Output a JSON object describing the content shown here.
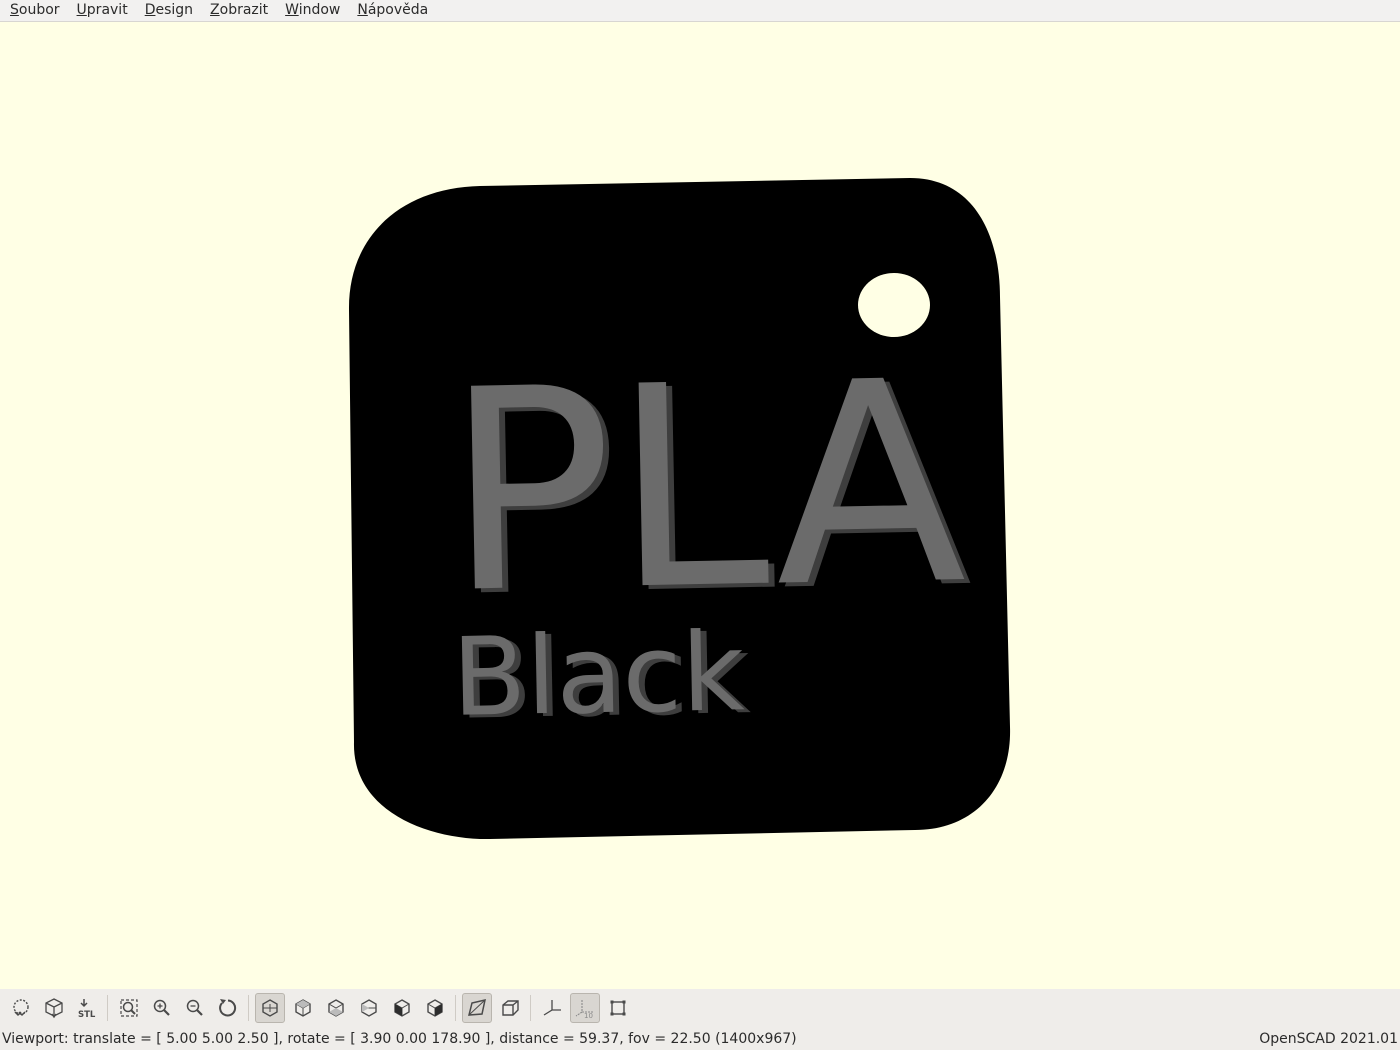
{
  "menubar": {
    "items": [
      {
        "label": "Soubor",
        "mnemonic": "S",
        "rest": "oubor"
      },
      {
        "label": "Upravit",
        "mnemonic": "U",
        "rest": "pravit"
      },
      {
        "label": "Design",
        "mnemonic": "D",
        "rest": "esign"
      },
      {
        "label": "Zobrazit",
        "mnemonic": "Z",
        "rest": "obrazit"
      },
      {
        "label": "Window",
        "mnemonic": "W",
        "rest": "indow"
      },
      {
        "label": "Nápověda",
        "mnemonic": "N",
        "rest": "ápověda"
      }
    ]
  },
  "model": {
    "main_text": "PLA",
    "sub_text": "Black",
    "tag_color": "#000000",
    "text_color": "#6b6b6b",
    "text_shadow_color": "#3e3e3e",
    "background_color": "#ffffe5"
  },
  "toolbar": {
    "buttons": [
      {
        "name": "preview-icon",
        "active": false
      },
      {
        "name": "render-icon",
        "active": false
      },
      {
        "name": "export-stl-icon",
        "active": false,
        "label": "STL"
      },
      {
        "sep": true
      },
      {
        "name": "view-all-icon",
        "active": false
      },
      {
        "name": "zoom-in-icon",
        "active": false
      },
      {
        "name": "zoom-out-icon",
        "active": false
      },
      {
        "name": "reset-view-icon",
        "active": false
      },
      {
        "sep": true
      },
      {
        "name": "view-diagonal-icon",
        "active": true
      },
      {
        "name": "view-top-icon",
        "active": false
      },
      {
        "name": "view-bottom-icon",
        "active": false
      },
      {
        "name": "view-left-icon",
        "active": false
      },
      {
        "name": "view-right-icon",
        "active": false
      },
      {
        "name": "view-front-icon",
        "active": false
      },
      {
        "sep": true
      },
      {
        "name": "perspective-icon",
        "active": true
      },
      {
        "name": "orthogonal-icon",
        "active": false
      },
      {
        "sep": true
      },
      {
        "name": "show-axes-icon",
        "active": false
      },
      {
        "name": "show-scale-markers-icon",
        "active": true,
        "label": "10"
      },
      {
        "name": "show-edges-icon",
        "active": false
      }
    ]
  },
  "statusbar": {
    "viewport_info": "Viewport: translate = [ 5.00 5.00 2.50 ], rotate = [ 3.90 0.00 178.90 ], distance = 59.37, fov = 22.50 (1400x967)",
    "app_version": "OpenSCAD 2021.01"
  }
}
